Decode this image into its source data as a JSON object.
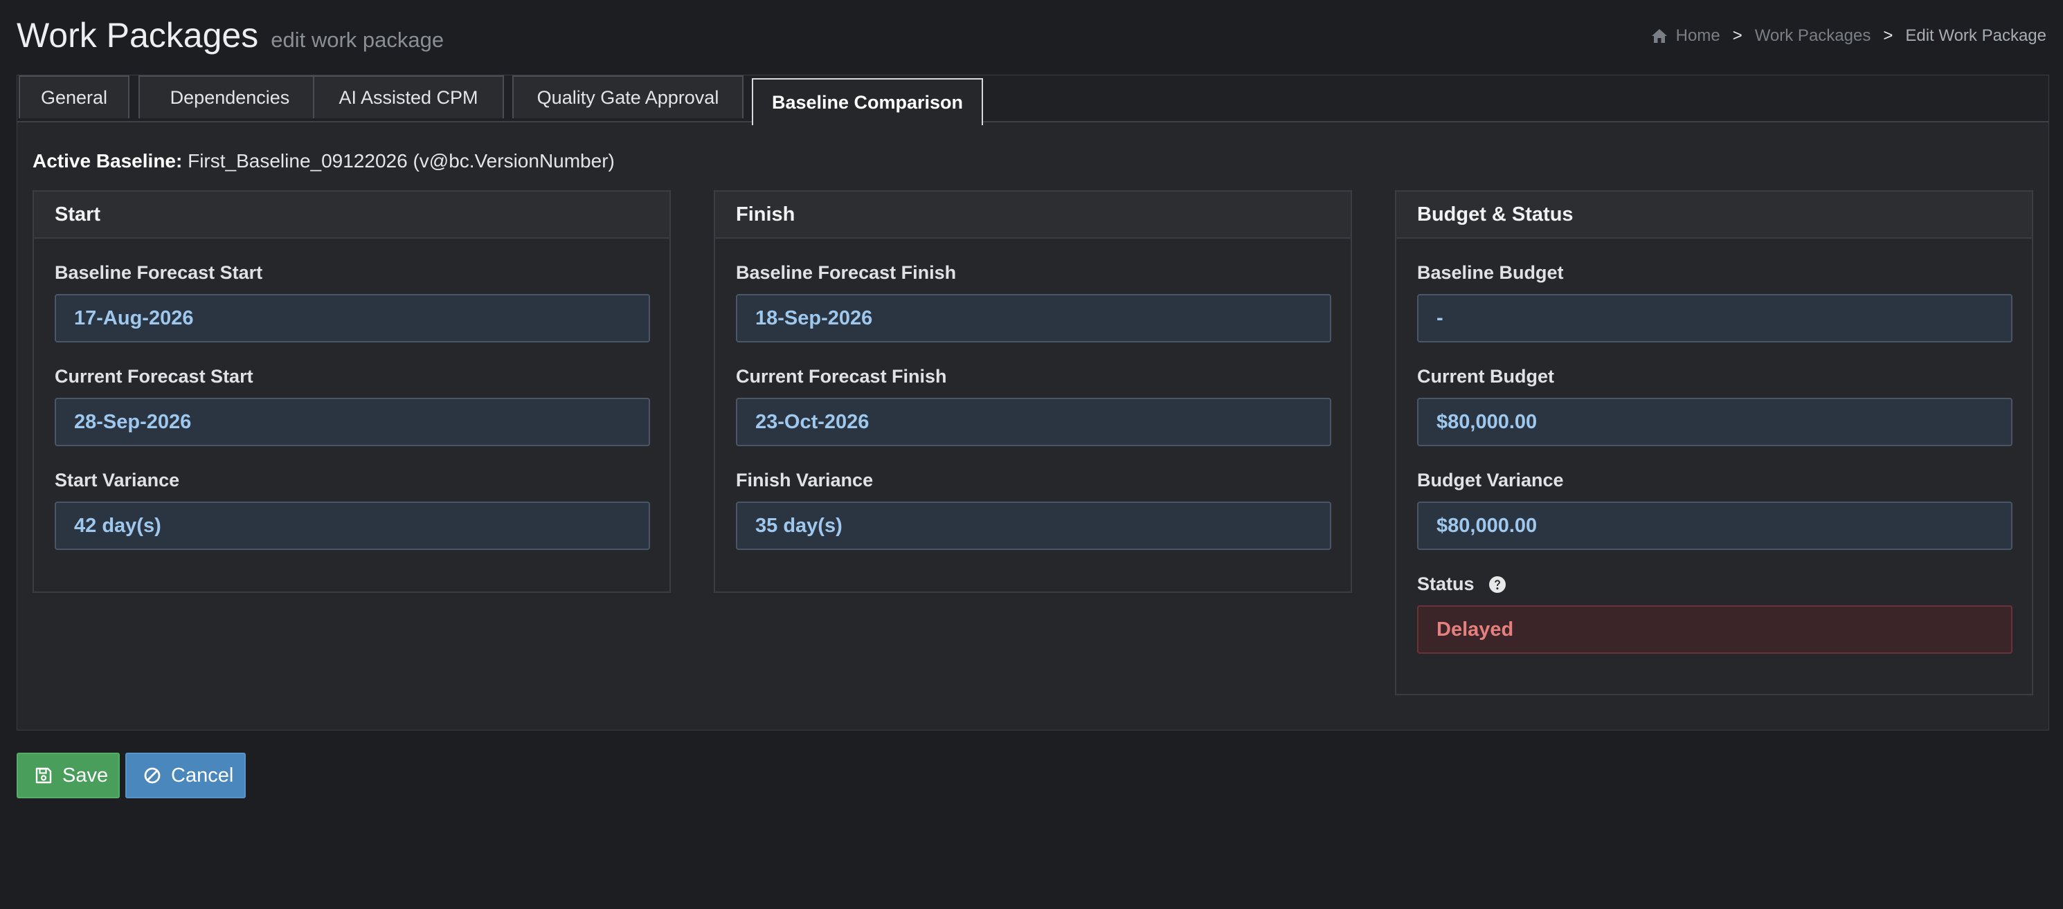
{
  "header": {
    "title": "Work Packages",
    "subtitle": "edit work package"
  },
  "breadcrumb": {
    "home": "Home",
    "separator": ">",
    "work_packages": "Work Packages",
    "current": "Edit Work Package"
  },
  "tabs": [
    {
      "label": "General",
      "active": false
    },
    {
      "label": "Dependencies",
      "active": false
    },
    {
      "label": "AI Assisted CPM",
      "active": false
    },
    {
      "label": "Quality Gate Approval",
      "active": false
    },
    {
      "label": "Baseline Comparison",
      "active": true
    }
  ],
  "active_baseline": {
    "label": "Active Baseline:",
    "value": "First_Baseline_09122026 (v@bc.VersionNumber)"
  },
  "start_panel": {
    "title": "Start",
    "baseline_forecast_label": "Baseline Forecast Start",
    "baseline_forecast_value": "17-Aug-2026",
    "current_forecast_label": "Current Forecast Start",
    "current_forecast_value": "28-Sep-2026",
    "variance_label": "Start Variance",
    "variance_value": "42 day(s)"
  },
  "finish_panel": {
    "title": "Finish",
    "baseline_forecast_label": "Baseline Forecast Finish",
    "baseline_forecast_value": "18-Sep-2026",
    "current_forecast_label": "Current Forecast Finish",
    "current_forecast_value": "23-Oct-2026",
    "variance_label": "Finish Variance",
    "variance_value": "35 day(s)"
  },
  "budget_panel": {
    "title": "Budget & Status",
    "baseline_budget_label": "Baseline Budget",
    "baseline_budget_value": "-",
    "current_budget_label": "Current Budget",
    "current_budget_value": "$80,000.00",
    "variance_label": "Budget Variance",
    "variance_value": "$80,000.00",
    "status_label": "Status",
    "status_value": "Delayed"
  },
  "actions": {
    "save_label": "Save",
    "cancel_label": "Cancel"
  },
  "icons": {
    "home": "home-icon",
    "help": "question-circle-icon",
    "save": "floppy-disk-icon",
    "cancel": "ban-icon"
  },
  "colors": {
    "background": "#1d1e22",
    "value_text": "#9ec8ee",
    "danger_text": "#e4807d",
    "save_button": "#4a9e5b",
    "cancel_button": "#4a87bd"
  }
}
